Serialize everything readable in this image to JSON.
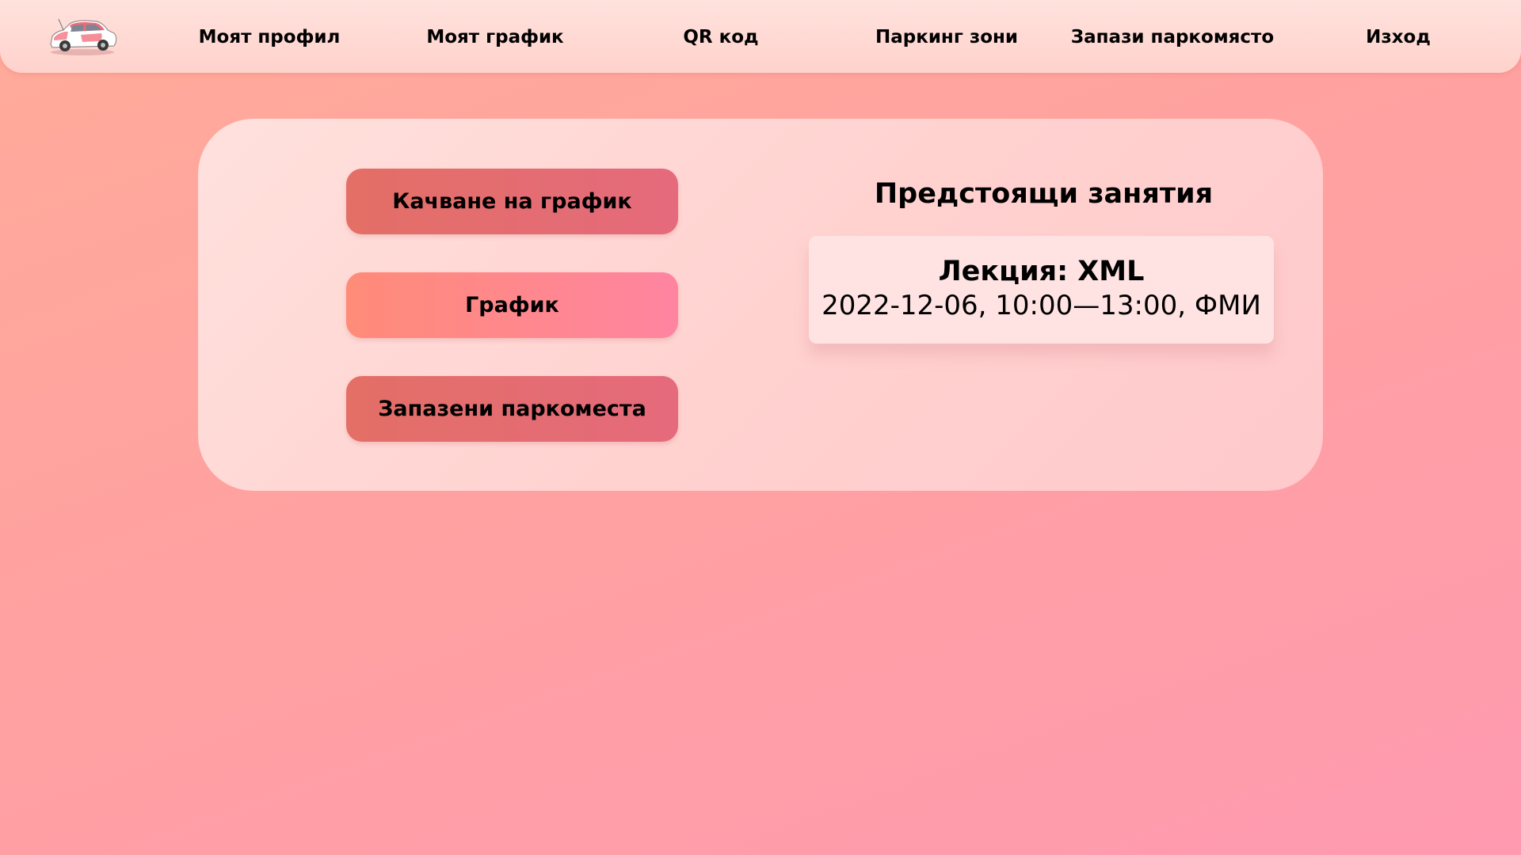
{
  "nav": {
    "logo_icon": "car-logo-icon",
    "items": [
      {
        "label": "Моят профил"
      },
      {
        "label": "Моят график"
      },
      {
        "label": "QR код"
      },
      {
        "label": "Паркинг зони"
      },
      {
        "label": "Запази паркомясто"
      },
      {
        "label": "Изход"
      }
    ]
  },
  "main": {
    "buttons": {
      "upload_schedule": "Качване на график",
      "schedule": "График",
      "saved_parking": "Запазени паркоместа"
    },
    "upcoming": {
      "title": "Предстоящи занятия",
      "events": [
        {
          "title": "Лекция: XML",
          "details": "2022-12-06, 10:00—13:00, ФМИ"
        }
      ]
    }
  },
  "colors": {
    "background": "#ffa1a0",
    "nav_bar": "#ffd8d3",
    "card": "#ffd6d5",
    "button_dark": "#e46d72",
    "button_light": "#ff8890",
    "event_card": "#ffe3e3"
  }
}
